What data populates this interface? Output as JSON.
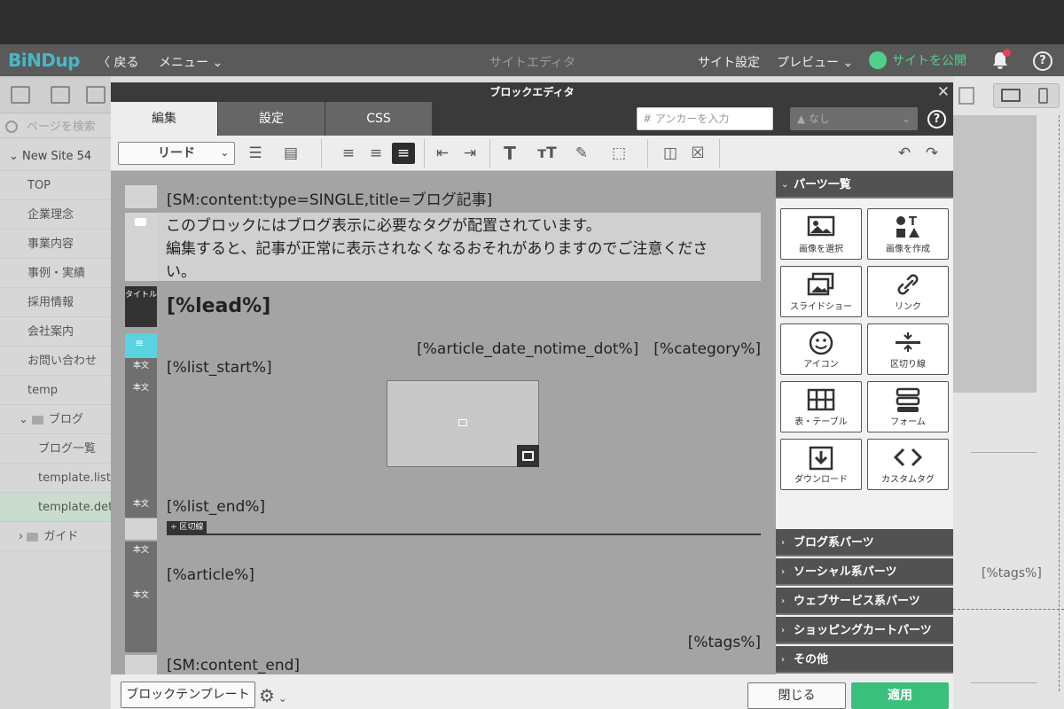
{
  "app": {
    "logo": "BiNDup",
    "back": "戻る",
    "menu": "メニュー",
    "title": "サイトエディタ",
    "site_settings": "サイト設定",
    "preview": "プレビュー",
    "publish": "サイトを公開",
    "accent_color": "#47b7c7",
    "publish_color": "#4fcf8c"
  },
  "sidebar": {
    "search_placeholder": "ページを検索",
    "site_name": "New Site 54",
    "pages": [
      "TOP",
      "企業理念",
      "事業内容",
      "事例・実績",
      "採用情報",
      "会社案内",
      "お問い合わせ",
      "temp"
    ],
    "folder_blog": "ブログ",
    "blog_pages": [
      "ブログ一覧",
      "template.list",
      "template.detail"
    ],
    "folder_guide": "ガイド"
  },
  "bg_editor": {
    "tags": "[%tags%]"
  },
  "modal": {
    "title": "ブロックエディタ",
    "tabs": [
      "編集",
      "設定",
      "CSS"
    ],
    "anchor_placeholder": "アンカーを入力",
    "anchor_prefix": "#",
    "anchor_select": "なし",
    "style_select": "リード"
  },
  "content": {
    "sm_start": "[SM:content:type=SINGLE,title=ブログ記事]",
    "notice_line1": "このブロックにはブログ表示に必要なタグが配置されています。",
    "notice_line2": "編集すると、記事が正常に表示されなくなるおそれがありますのでご注意くださ",
    "notice_line3": "い。",
    "title_label": "タイトル",
    "lead": "[%lead%]",
    "body_label": "本文",
    "article_meta": "[%article_date_notime_dot%]　[%category%]",
    "list_start": "[%list_start%]",
    "list_end": "[%list_end%]",
    "divider_label": "区切線",
    "article": "[%article%]",
    "tags": "[%tags%]",
    "sm_end": "[SM:content_end]"
  },
  "parts": {
    "header": "パーツ一覧",
    "items": [
      "画像を選択",
      "画像を作成",
      "スライドショー",
      "リンク",
      "アイコン",
      "区切り線",
      "表・テーブル",
      "フォーム",
      "ダウンロード",
      "カスタムタグ"
    ],
    "sections": [
      "ブログ系パーツ",
      "ソーシャル系パーツ",
      "ウェブサービス系パーツ",
      "ショッピングカートパーツ",
      "その他"
    ]
  },
  "footer": {
    "template_button": "ブロックテンプレート",
    "close_button": "閉じる",
    "apply_button": "適用",
    "apply_color": "#3bbf7c"
  }
}
